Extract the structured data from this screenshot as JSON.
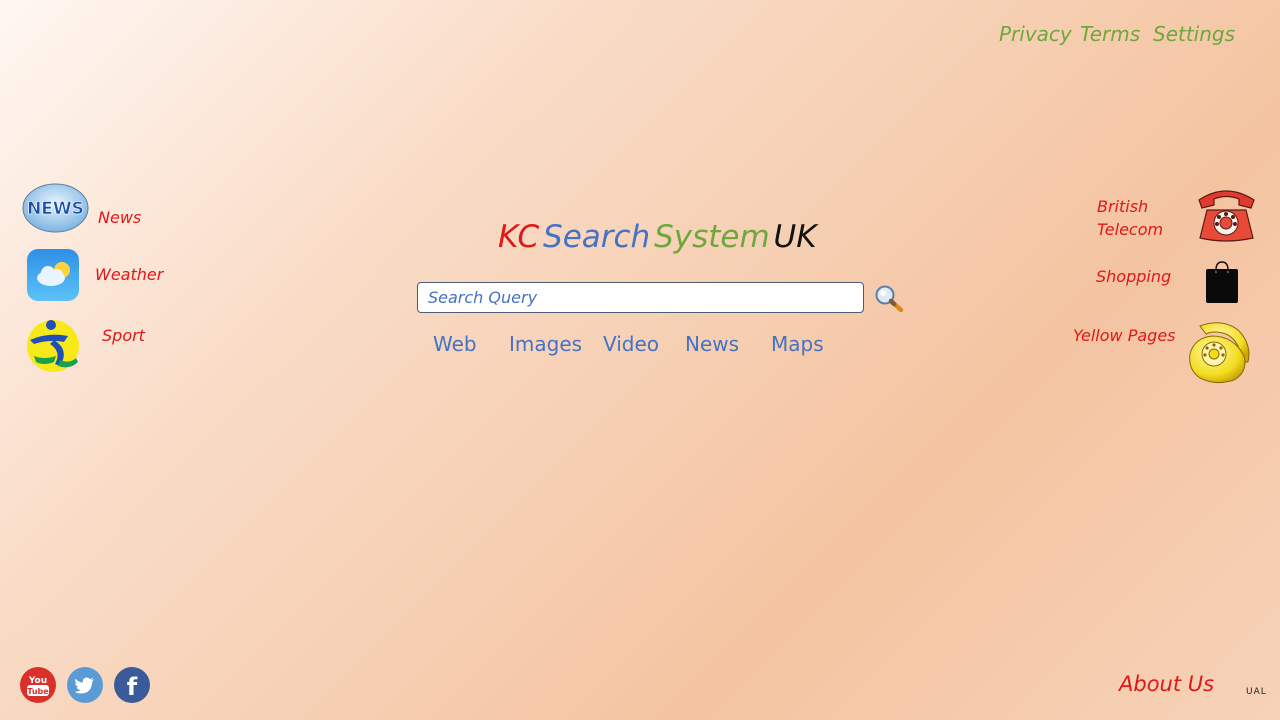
{
  "header": {
    "links": [
      "Privacy",
      "Terms",
      "Settings"
    ]
  },
  "logo": {
    "part1": "KC",
    "part2": "Search",
    "part3": "System",
    "part4": "UK"
  },
  "search": {
    "placeholder": "Search Query",
    "value": ""
  },
  "tabs": [
    "Web",
    "Images",
    "Video",
    "News",
    "Maps"
  ],
  "left_links": [
    {
      "label": "News",
      "icon": "news-icon"
    },
    {
      "label": "Weather",
      "icon": "weather-icon"
    },
    {
      "label": "Sport",
      "icon": "sport-icon"
    }
  ],
  "right_links": [
    {
      "label_line1": "British",
      "label_line2": "Telecom",
      "icon": "telephone-icon"
    },
    {
      "label": "Shopping",
      "icon": "shopping-bag-icon"
    },
    {
      "label": "Yellow Pages",
      "icon": "yellow-phone-icon"
    }
  ],
  "news_icon_text": "NEWS",
  "social": [
    {
      "name": "youtube-icon",
      "text_top": "You",
      "text_bottom": "Tube",
      "color": "#d9302a"
    },
    {
      "name": "twitter-icon",
      "color": "#5b9bd5"
    },
    {
      "name": "facebook-icon",
      "text": "f",
      "color": "#3b5a9a"
    }
  ],
  "footer": {
    "about": "About Us",
    "mark": "UAL"
  },
  "colors": {
    "red": "#e01818",
    "blue": "#4472c4",
    "green": "#6fa83a"
  }
}
